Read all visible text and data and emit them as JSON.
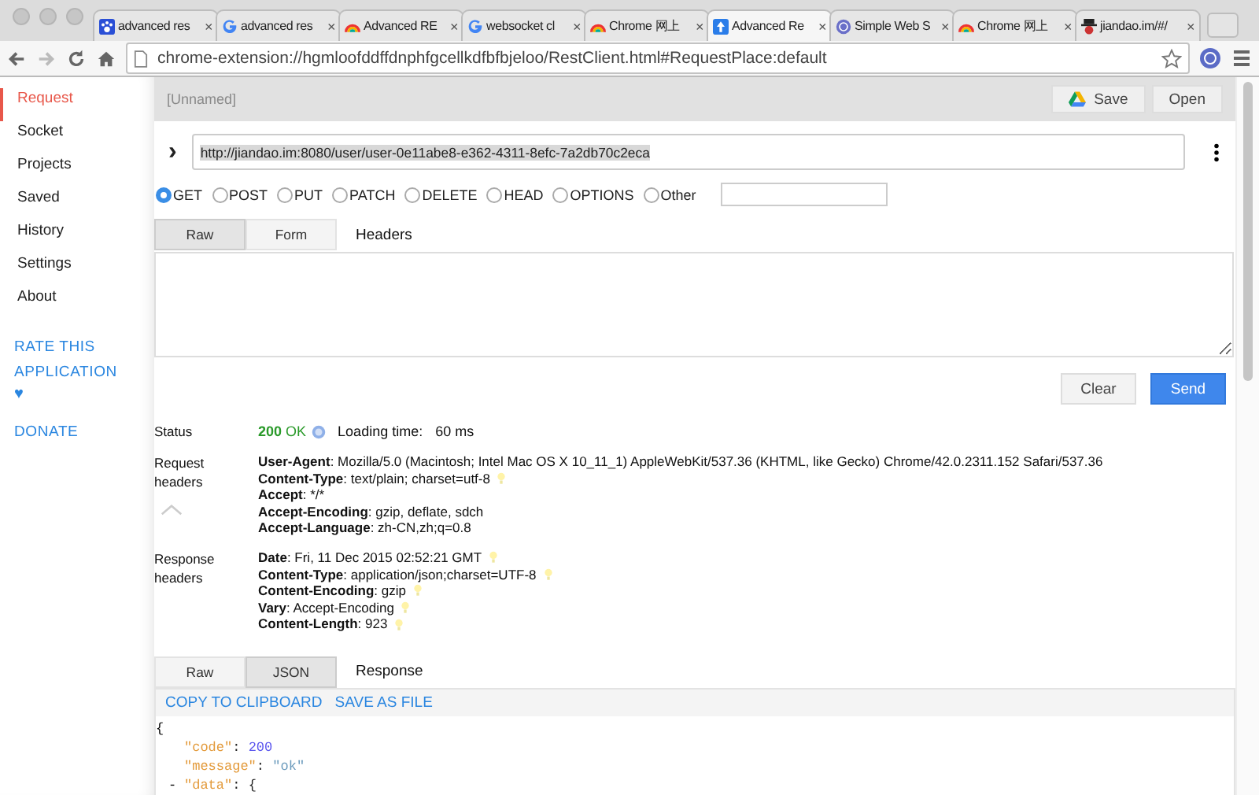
{
  "browser": {
    "tabs": [
      {
        "title": "advanced res",
        "kind": "paw",
        "selected": false
      },
      {
        "title": "advanced res",
        "kind": "g",
        "selected": false
      },
      {
        "title": "Advanced RE",
        "kind": "rainbow",
        "selected": false
      },
      {
        "title": "websocket cl",
        "kind": "g",
        "selected": false
      },
      {
        "title": "Chrome 网上",
        "kind": "rainbow",
        "selected": false
      },
      {
        "title": "Advanced Re",
        "kind": "arrow",
        "selected": true
      },
      {
        "title": "Simple Web S",
        "kind": "ws",
        "selected": false
      },
      {
        "title": "Chrome 网上",
        "kind": "rainbow",
        "selected": false
      },
      {
        "title": "jiandao.im/#/",
        "kind": "figure",
        "selected": false
      }
    ],
    "close_label": "×",
    "address": "chrome-extension://hgmloofddffdnphfgcellkdfbfbjeloo/RestClient.html#RequestPlace:default"
  },
  "sidebar": {
    "items": [
      {
        "label": "Request",
        "selected": true
      },
      {
        "label": "Socket",
        "selected": false
      },
      {
        "label": "Projects",
        "selected": false
      },
      {
        "label": "Saved",
        "selected": false
      },
      {
        "label": "History",
        "selected": false
      },
      {
        "label": "Settings",
        "selected": false
      },
      {
        "label": "About",
        "selected": false
      }
    ],
    "rate_link": "RATE THIS APPLICATION",
    "heart": "♥",
    "donate_link": "DONATE"
  },
  "request": {
    "name_placeholder": "[Unnamed]",
    "save_button": "Save",
    "open_button": "Open",
    "expand_icon": "›",
    "url": "http://jiandao.im:8080/user/user-0e11abe8-e362-4311-8efc-7a2db70c2eca",
    "methods": [
      {
        "label": "GET",
        "selected": true
      },
      {
        "label": "POST",
        "selected": false
      },
      {
        "label": "PUT",
        "selected": false
      },
      {
        "label": "PATCH",
        "selected": false
      },
      {
        "label": "DELETE",
        "selected": false
      },
      {
        "label": "HEAD",
        "selected": false
      },
      {
        "label": "OPTIONS",
        "selected": false
      },
      {
        "label": "Other",
        "selected": false
      }
    ],
    "header_tabs": [
      {
        "label": "Raw",
        "selected": true
      },
      {
        "label": "Form",
        "selected": false
      }
    ],
    "headers_title": "Headers",
    "clear_button": "Clear",
    "send_button": "Send"
  },
  "response": {
    "status_label": "Status",
    "status_code": "200",
    "status_text": "OK",
    "loading_label": "Loading time:",
    "loading_value": "60 ms",
    "request_headers_label": "Request headers",
    "request_headers": [
      {
        "name": "User-Agent",
        "separator": ":",
        "value": "Mozilla/5.0 (Macintosh; Intel Mac OS X 10_11_1) AppleWebKit/537.36 (KHTML, like Gecko) Chrome/42.0.2311.152 Safari/537.36",
        "hint": false
      },
      {
        "name": "Content-Type",
        "separator": ":",
        "value": "text/plain; charset=utf-8",
        "hint": true
      },
      {
        "name": "Accept",
        "separator": ":",
        "value": "*/*",
        "hint": false
      },
      {
        "name": "Accept-Encoding",
        "separator": ":",
        "value": "gzip, deflate, sdch",
        "hint": false
      },
      {
        "name": "Accept-Language",
        "separator": ":",
        "value": "zh-CN,zh;q=0.8",
        "hint": false
      }
    ],
    "response_headers_label": "Response headers",
    "response_headers": [
      {
        "name": "Date",
        "separator": ":",
        "value": "Fri, 11 Dec 2015 02:52:21 GMT",
        "hint": true
      },
      {
        "name": "Content-Type",
        "separator": ":",
        "value": "application/json;charset=UTF-8",
        "hint": true
      },
      {
        "name": "Content-Encoding",
        "separator": ":",
        "value": "gzip",
        "hint": true
      },
      {
        "name": "Vary",
        "separator": ":",
        "value": "Accept-Encoding",
        "hint": true
      },
      {
        "name": "Content-Length",
        "separator": ":",
        "value": "923",
        "hint": true
      }
    ],
    "body_tabs": [
      {
        "label": "Raw",
        "selected": false
      },
      {
        "label": "JSON",
        "selected": true
      }
    ],
    "body_title": "Response",
    "copy_link": "COPY TO CLIPBOARD",
    "save_link": "SAVE AS FILE",
    "json_lines": [
      {
        "kind": "open",
        "text": "{"
      },
      {
        "kind": "number",
        "key": "\"code\"",
        "separator": ":",
        "value": "200"
      },
      {
        "kind": "string",
        "key": "\"message\"",
        "separator": ":",
        "value": "\"ok\""
      },
      {
        "kind": "object",
        "toggle": "-",
        "key": "\"data\"",
        "separator": ":",
        "value": "{"
      }
    ]
  }
}
